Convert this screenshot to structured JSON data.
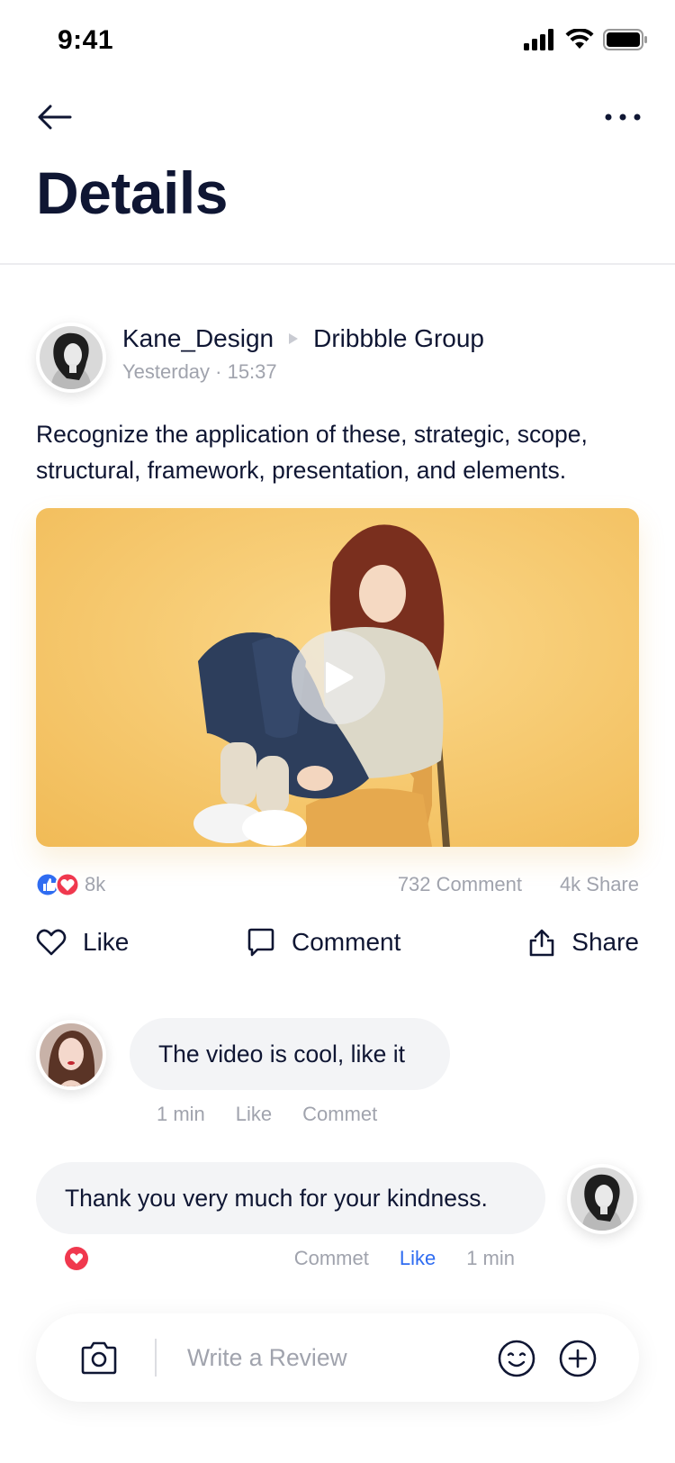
{
  "status_bar": {
    "time": "9:41"
  },
  "header": {
    "title": "Details"
  },
  "post": {
    "author": "Kane_Design",
    "group": "Dribbble Group",
    "time": "Yesterday · 15:37",
    "text": "Recognize the application of these, strategic, scope, structural, framework, presentation, and elements.",
    "media_type": "video",
    "stats": {
      "reactions": "8k",
      "comments": "732 Comment",
      "shares": "4k Share"
    },
    "actions": {
      "like": "Like",
      "comment": "Comment",
      "share": "Share"
    }
  },
  "comments": [
    {
      "text": "The video is cool, like it",
      "time": "1 min",
      "like": "Like",
      "reply": "Commet"
    },
    {
      "text": "Thank you very much for your kindness.",
      "reply": "Commet",
      "like": "Like",
      "time": "1 min"
    }
  ],
  "composer": {
    "placeholder": "Write a Review"
  },
  "colors": {
    "text": "#0f1633",
    "muted": "#a0a3ad",
    "accent": "#2f6cf1",
    "heart": "#f0384e",
    "bubble": "#f3f4f6"
  }
}
